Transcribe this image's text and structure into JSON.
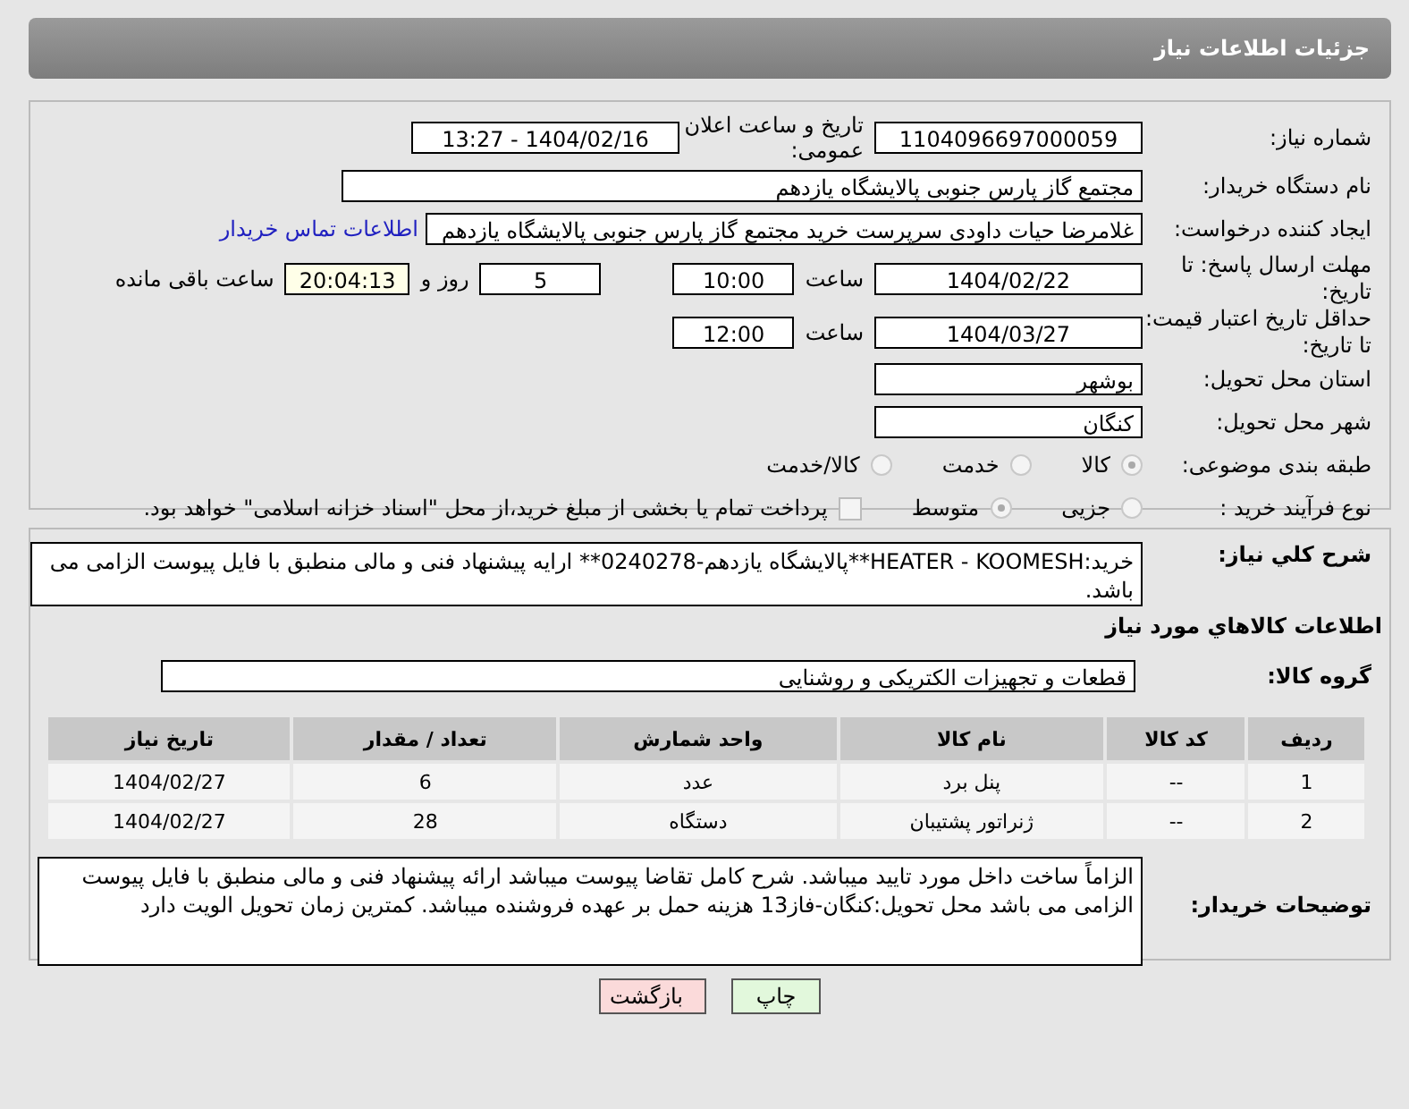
{
  "header": {
    "title": "جزئیات اطلاعات نیاز"
  },
  "fields": {
    "need_number": {
      "label": "شماره نیاز:",
      "value": "1104096697000059"
    },
    "announce": {
      "label": "تاریخ و ساعت اعلان عمومی:",
      "value": "1404/02/16 - 13:27"
    },
    "buyer_org": {
      "label": "نام دستگاه خریدار:",
      "value": "مجتمع گاز پارس جنوبی  پالایشگاه یازدهم"
    },
    "creator": {
      "label": "ایجاد کننده درخواست:",
      "value": "غلامرضا حیات داودی سرپرست خرید مجتمع گاز پارس جنوبی  پالایشگاه یازدهم",
      "link": "اطلاعات تماس خریدار"
    },
    "deadline": {
      "label": "مهلت ارسال پاسخ: تا تاریخ:",
      "date": "1404/02/22",
      "time_label": "ساعت",
      "time": "10:00",
      "days": "5",
      "days_label": "روز و",
      "remaining": "20:04:13",
      "remaining_label": "ساعت باقی مانده"
    },
    "validity": {
      "label": "حداقل تاریخ اعتبار قیمت: تا تاریخ:",
      "date": "1404/03/27",
      "time_label": "ساعت",
      "time": "12:00"
    },
    "province": {
      "label": "استان محل تحویل:",
      "value": "بوشهر"
    },
    "city": {
      "label": "شهر محل تحویل:",
      "value": "کنگان"
    },
    "category": {
      "label": "طبقه بندی موضوعی:",
      "options": [
        {
          "label": "کالا",
          "selected": true
        },
        {
          "label": "خدمت",
          "selected": false
        },
        {
          "label": "کالا/خدمت",
          "selected": false
        }
      ]
    },
    "process": {
      "label": "نوع فرآیند خرید :",
      "options": [
        {
          "label": "جزیی",
          "selected": false
        },
        {
          "label": "متوسط",
          "selected": true
        }
      ],
      "payment": {
        "label": "پرداخت تمام یا بخشی از مبلغ خرید،از محل \"اسناد خزانه اسلامی\" خواهد بود.",
        "checked": false
      }
    }
  },
  "description": {
    "label": "شرح کلي نياز:",
    "value": "خرید:HEATER - KOOMESH**پالایشگاه یازدهم-0240278** ارایه پیشنهاد فنی و مالی منطبق با فایل پیوست الزامی می باشد."
  },
  "goods": {
    "title": "اطلاعات کالاهاي مورد نياز",
    "group_label": "گروه کالا:",
    "group": "قطعات و تجهیزات الکتریکی و روشنایی",
    "columns": [
      "ردیف",
      "کد کالا",
      "نام کالا",
      "واحد شمارش",
      "تعداد / مقدار",
      "تاریخ نیاز"
    ],
    "rows": [
      [
        "1",
        "--",
        "پنل برد",
        "عدد",
        "6",
        "1404/02/27"
      ],
      [
        "2",
        "--",
        "ژنراتور پشتیبان",
        "دستگاه",
        "28",
        "1404/02/27"
      ]
    ]
  },
  "buyer_notes": {
    "label": "توضیحات خریدار:",
    "value": "الزاماً ساخت داخل مورد تایید میباشد. شرح کامل تقاضا پیوست میباشد ارائه پیشنهاد فنی و مالی منطبق با فایل پیوست الزامی می باشد محل تحویل:کنگان-فاز13 هزینه حمل بر عهده فروشنده میباشد. کمترین زمان تحویل الویت دارد"
  },
  "buttons": [
    {
      "label": "چاپ",
      "kind": "print"
    },
    {
      "label": "بازگشت",
      "kind": "back"
    }
  ]
}
